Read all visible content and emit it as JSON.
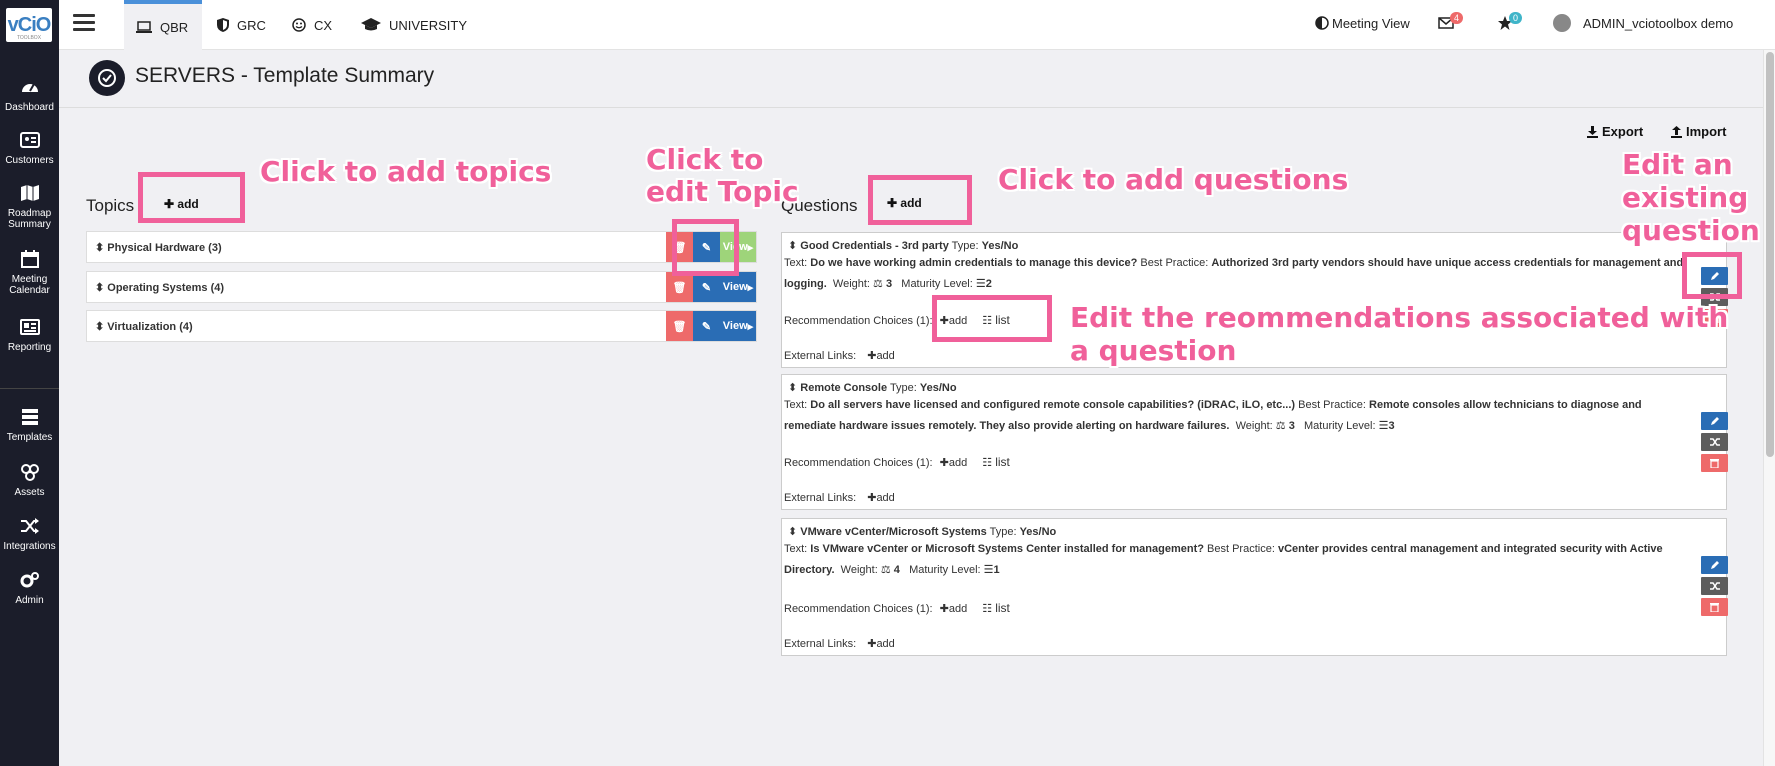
{
  "app": {
    "logo_text": "vCiO",
    "logo_sub": "TOOLBOX"
  },
  "sidebar": {
    "items": [
      {
        "label": "Dashboard",
        "icon": "dashboard-icon"
      },
      {
        "label": "Customers",
        "icon": "customers-icon"
      },
      {
        "label": "Roadmap Summary",
        "icon": "map-icon"
      },
      {
        "label": "Meeting Calendar",
        "icon": "calendar-icon"
      },
      {
        "label": "Reporting",
        "icon": "reporting-icon"
      },
      {
        "label": "Templates",
        "icon": "templates-icon"
      },
      {
        "label": "Assets",
        "icon": "assets-icon"
      },
      {
        "label": "Integrations",
        "icon": "integrations-icon"
      },
      {
        "label": "Admin",
        "icon": "admin-icon"
      }
    ]
  },
  "topbar": {
    "tabs": [
      {
        "label": "QBR",
        "icon": "laptop-icon",
        "active": true
      },
      {
        "label": "GRC",
        "icon": "shield-icon"
      },
      {
        "label": "CX",
        "icon": "smile-icon"
      },
      {
        "label": "UNIVERSITY",
        "icon": "graduation-cap-icon"
      }
    ],
    "meeting_view": "Meeting View",
    "mail_count": "4",
    "star_count": "0",
    "user": "ADMIN_vciotoolbox demo"
  },
  "page": {
    "title": "SERVERS - Template Summary"
  },
  "toolbar": {
    "export_label": "Export",
    "import_label": "Import"
  },
  "topics": {
    "title": "Topics",
    "add_label": "add",
    "view_label": "View",
    "items": [
      {
        "name": "Physical Hardware (3)"
      },
      {
        "name": "Operating Systems (4)"
      },
      {
        "name": "Virtualization (4)"
      }
    ]
  },
  "questions": {
    "title": "Questions",
    "add_label": "add",
    "labels": {
      "type": "Type:",
      "text": "Text:",
      "best_practice": "Best Practice:",
      "weight": "Weight:",
      "maturity": "Maturity Level:",
      "recommendations": "Recommendation Choices (1):",
      "external_links": "External Links:",
      "add": "add",
      "list": "list"
    },
    "items": [
      {
        "title": "Good Credentials - 3rd party",
        "type": "Yes/No",
        "text": "Do we have working admin credentials to manage this device?",
        "best_practice": "Authorized 3rd party vendors should have unique access credentials for management and logging.",
        "weight": "3",
        "maturity": "2"
      },
      {
        "title": "Remote Console",
        "type": "Yes/No",
        "text": "Do all servers have licensed and configured remote console capabilities? (iDRAC, iLO, etc...)",
        "best_practice": "Remote consoles allow technicians to diagnose and remediate hardware issues remotely. They also provide alerting on hardware failures.",
        "weight": "3",
        "maturity": "3"
      },
      {
        "title": "VMware vCenter/Microsoft Systems",
        "type": "Yes/No",
        "text": "Is VMware vCenter or Microsoft Systems Center installed for management?",
        "best_practice": "vCenter provides central management and integrated security with Active Directory.",
        "weight": "4",
        "maturity": "1"
      }
    ]
  },
  "annotations": {
    "add_topics": "Click to add topics",
    "edit_topic_1": "Click to",
    "edit_topic_2": "edit Topic",
    "add_questions": "Click to add questions",
    "edit_question_1": "Edit an",
    "edit_question_2": "existing",
    "edit_question_3": "question",
    "edit_recs_1": "Edit the reommendations associated with",
    "edit_recs_2": "a question"
  },
  "colors": {
    "accent": "#f0609a",
    "primary": "#2a6db5",
    "danger": "#ee6a6a",
    "sidebar": "#1b1d2a"
  }
}
